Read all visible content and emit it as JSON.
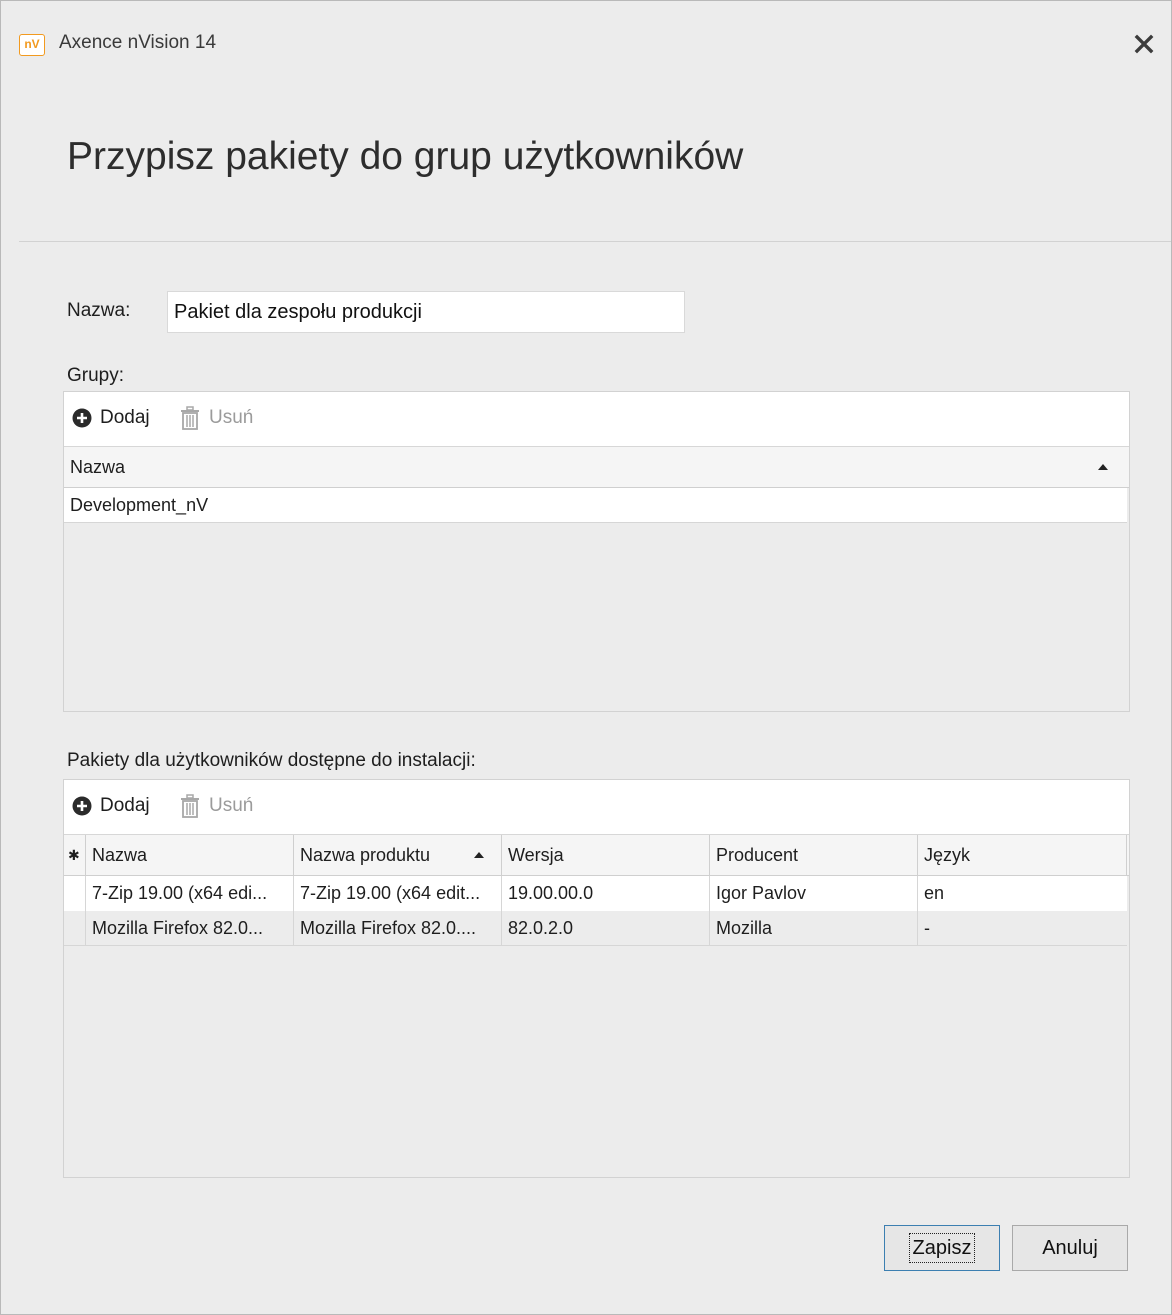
{
  "window": {
    "app_icon_text": "nV",
    "app_title": "Axence nVision 14",
    "dialog_title": "Przypisz pakiety do grup użytkowników"
  },
  "form": {
    "name_label": "Nazwa:",
    "name_value": "Pakiet dla zespołu produkcji"
  },
  "groups": {
    "section_label": "Grupy:",
    "toolbar": {
      "add_label": "Dodaj",
      "remove_label": "Usuń"
    },
    "columns": [
      "Nazwa"
    ],
    "rows": [
      [
        "Development_nV"
      ]
    ]
  },
  "packages": {
    "section_label": "Pakiety dla użytkowników dostępne do instalacji:",
    "toolbar": {
      "add_label": "Dodaj",
      "remove_label": "Usuń"
    },
    "columns": [
      "Nazwa",
      "Nazwa produktu",
      "Wersja",
      "Producent",
      "Język"
    ],
    "rows": [
      [
        "7-Zip 19.00 (x64 edi...",
        "7-Zip 19.00 (x64 edit...",
        "19.00.00.0",
        "Igor Pavlov",
        "en"
      ],
      [
        "Mozilla Firefox 82.0...",
        "Mozilla Firefox 82.0....",
        "82.0.2.0",
        "Mozilla",
        "-"
      ]
    ]
  },
  "buttons": {
    "save_label": "Zapisz",
    "cancel_label": "Anuluj"
  },
  "colors": {
    "accent": "#f29a1f",
    "primary_border": "#3c7fb1"
  }
}
